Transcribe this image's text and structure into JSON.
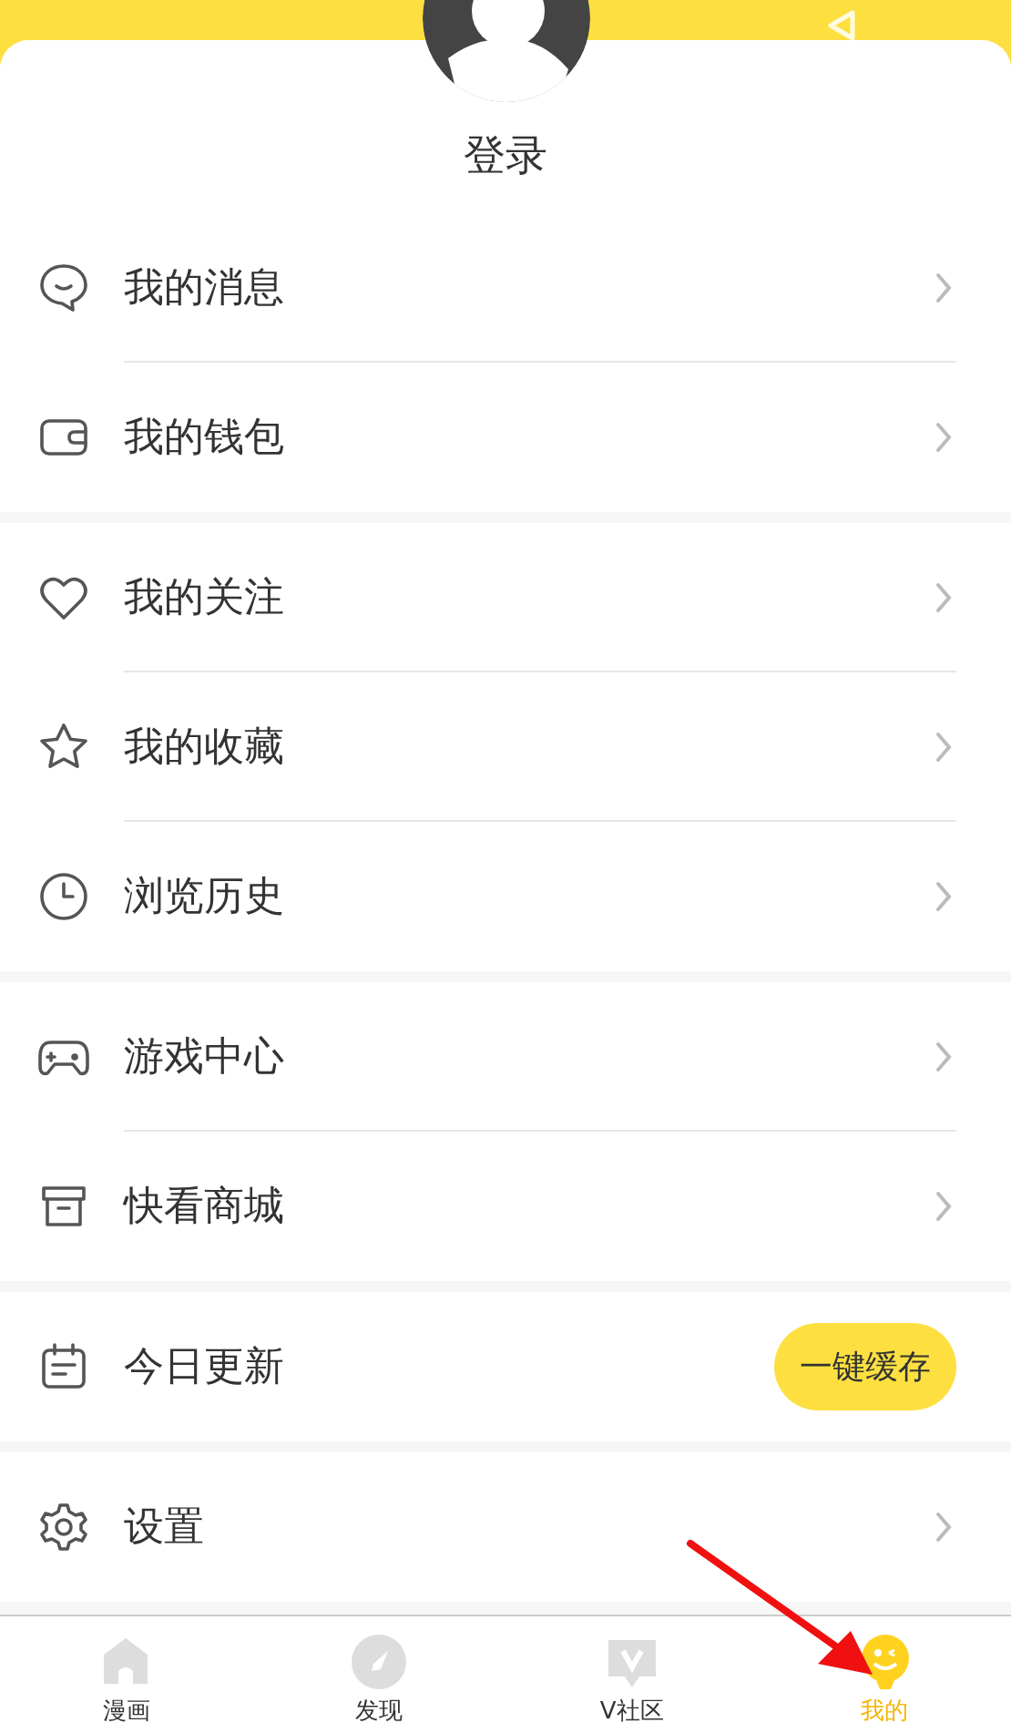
{
  "profile": {
    "login": "登录"
  },
  "groups": [
    {
      "items": [
        {
          "label": "我的消息",
          "kind": "link"
        },
        {
          "label": "我的钱包",
          "kind": "link"
        }
      ]
    },
    {
      "items": [
        {
          "label": "我的关注",
          "kind": "link"
        },
        {
          "label": "我的收藏",
          "kind": "link"
        },
        {
          "label": "浏览历史",
          "kind": "link"
        }
      ]
    },
    {
      "items": [
        {
          "label": "游戏中心",
          "kind": "link"
        },
        {
          "label": "快看商城",
          "kind": "link"
        }
      ]
    },
    {
      "items": [
        {
          "label": "今日更新",
          "kind": "action",
          "action": "一键缓存"
        }
      ]
    },
    {
      "items": [
        {
          "label": "设置",
          "kind": "link"
        }
      ]
    }
  ],
  "tabs": [
    {
      "label": "漫画",
      "selected": false
    },
    {
      "label": "发现",
      "selected": false
    },
    {
      "label": "V社区",
      "selected": false
    },
    {
      "label": "我的",
      "selected": true
    }
  ]
}
